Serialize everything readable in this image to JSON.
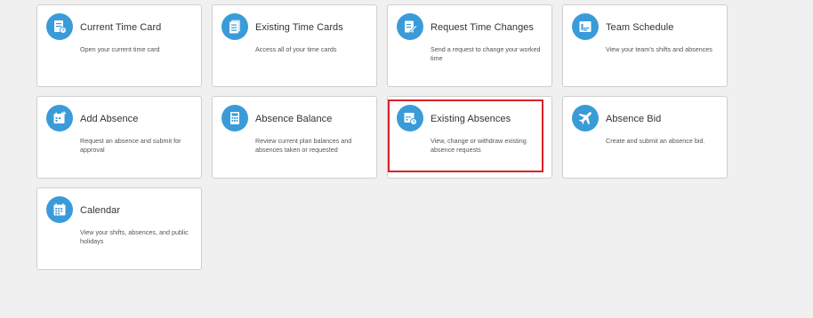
{
  "colors": {
    "page_background": "#f0f0f0",
    "tile_background": "#ffffff",
    "icon_background": "#3a9bd9",
    "highlight_border": "#d92128"
  },
  "tiles": [
    {
      "title": "Current Time Card",
      "description": "Open your current time card",
      "icon": "time-card-icon"
    },
    {
      "title": "Existing Time Cards",
      "description": "Access all of your time cards",
      "icon": "time-cards-list-icon"
    },
    {
      "title": "Request Time Changes",
      "description": "Send a request to change your worked time",
      "icon": "edit-document-icon"
    },
    {
      "title": "Team Schedule",
      "description": "View your team's shifts and absences",
      "icon": "team-schedule-icon"
    },
    {
      "title": "Add Absence",
      "description": "Request an absence and submit for approval",
      "icon": "add-absence-calendar-icon"
    },
    {
      "title": "Absence Balance",
      "description": "Review current plan balances and absences taken or requested",
      "icon": "calculator-icon"
    },
    {
      "title": "Existing Absences",
      "description": "View, change or withdraw existing absence requests",
      "icon": "existing-absences-icon"
    },
    {
      "title": "Absence Bid",
      "description": "Create and submit an absence bid.",
      "icon": "airplane-icon"
    },
    {
      "title": "Calendar",
      "description": "View your shifts, absences, and public holidays",
      "icon": "calendar-icon"
    }
  ]
}
